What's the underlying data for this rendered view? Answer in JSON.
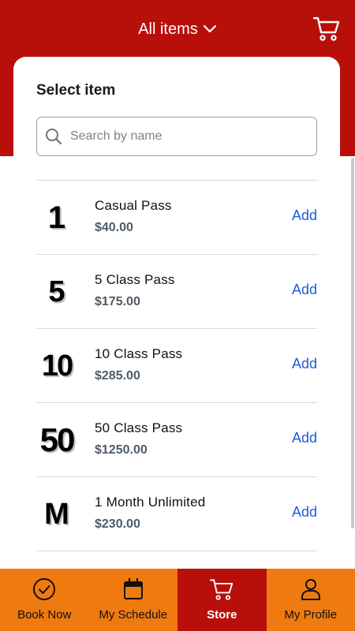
{
  "header": {
    "category_label": "All items",
    "cart_icon": "cart-icon",
    "background_color": "#b80f0a"
  },
  "card": {
    "title": "Select item",
    "search": {
      "placeholder": "Search by name",
      "value": ""
    }
  },
  "items": [
    {
      "glyph": "1",
      "name": "Casual Pass",
      "price": "$40.00",
      "action": "Add"
    },
    {
      "glyph": "5",
      "name": "5 Class Pass",
      "price": "$175.00",
      "action": "Add"
    },
    {
      "glyph": "10",
      "name": "10 Class Pass",
      "price": "$285.00",
      "action": "Add"
    },
    {
      "glyph": "50",
      "name": "50 Class Pass",
      "price": "$1250.00",
      "action": "Add"
    },
    {
      "glyph": "M",
      "name": "1 Month Unlimited",
      "price": "$230.00",
      "action": "Add"
    }
  ],
  "tabbar": {
    "tabs": [
      {
        "label": "Book Now",
        "icon": "check-circle-icon",
        "active": false
      },
      {
        "label": "My Schedule",
        "icon": "calendar-icon",
        "active": false
      },
      {
        "label": "Store",
        "icon": "cart-icon",
        "active": true
      },
      {
        "label": "My Profile",
        "icon": "person-icon",
        "active": false
      }
    ],
    "colors": {
      "tab_bg": "#ef7a10",
      "active_bg": "#b80f0a"
    }
  },
  "colors": {
    "link": "#1f5bd8",
    "price": "#4f5b66"
  }
}
